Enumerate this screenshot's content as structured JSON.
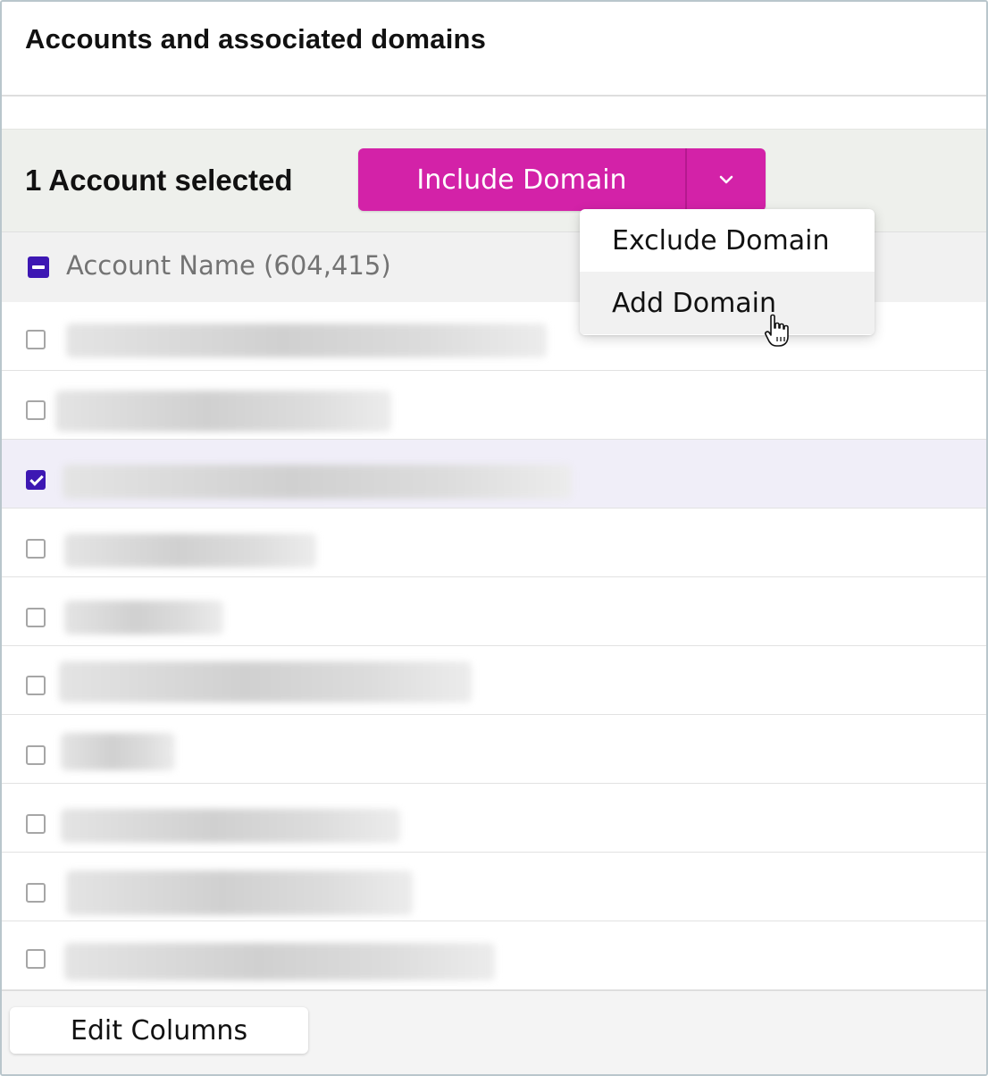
{
  "page": {
    "title": "Accounts and associated domains"
  },
  "selection": {
    "count_label": "1 Account selected"
  },
  "split_button": {
    "primary_label": "Include Domain",
    "caret_icon": "chevron-down-icon",
    "color": "#d322a8"
  },
  "dropdown": {
    "items": [
      {
        "label": "Exclude Domain"
      },
      {
        "label": "Add Domain"
      }
    ],
    "hovered_index": 1
  },
  "table": {
    "header": {
      "label": "Account Name (604,415)",
      "checkbox_state": "indeterminate"
    },
    "rows": [
      {
        "checked": false
      },
      {
        "checked": false
      },
      {
        "checked": true
      },
      {
        "checked": false
      },
      {
        "checked": false
      },
      {
        "checked": false
      },
      {
        "checked": false
      },
      {
        "checked": false
      },
      {
        "checked": false
      },
      {
        "checked": false
      }
    ]
  },
  "footer": {
    "edit_columns_label": "Edit Columns"
  },
  "colors": {
    "accent_purple": "#3d17b3",
    "selected_row": "#f0eef8"
  }
}
